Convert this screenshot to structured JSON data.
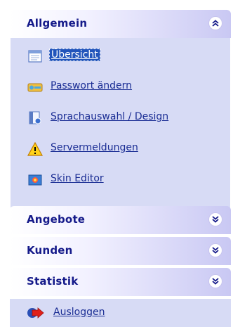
{
  "groups": [
    {
      "title": "Allgemein",
      "expanded": true,
      "items": [
        {
          "label": "Übersicht",
          "icon": "document-icon",
          "active": true
        },
        {
          "label": "Passwort ändern",
          "icon": "key-icon"
        },
        {
          "label": "Sprachauswahl / Design",
          "icon": "settings-doc-icon"
        },
        {
          "label": "Servermeldungen",
          "icon": "warning-icon"
        },
        {
          "label": "Skin Editor",
          "icon": "skin-editor-icon"
        }
      ]
    },
    {
      "title": "Angebote",
      "expanded": false
    },
    {
      "title": "Kunden",
      "expanded": false
    },
    {
      "title": "Statistik",
      "expanded": false
    }
  ],
  "logout": {
    "label": "Ausloggen",
    "icon": "logout-arrow-icon"
  },
  "colors": {
    "header_text": "#151a8a",
    "link_text": "#1a2d94",
    "panel_body": "#d7dbf5",
    "header_gradient_end": "#c9c8f3",
    "active_highlight": "#2255bb"
  }
}
